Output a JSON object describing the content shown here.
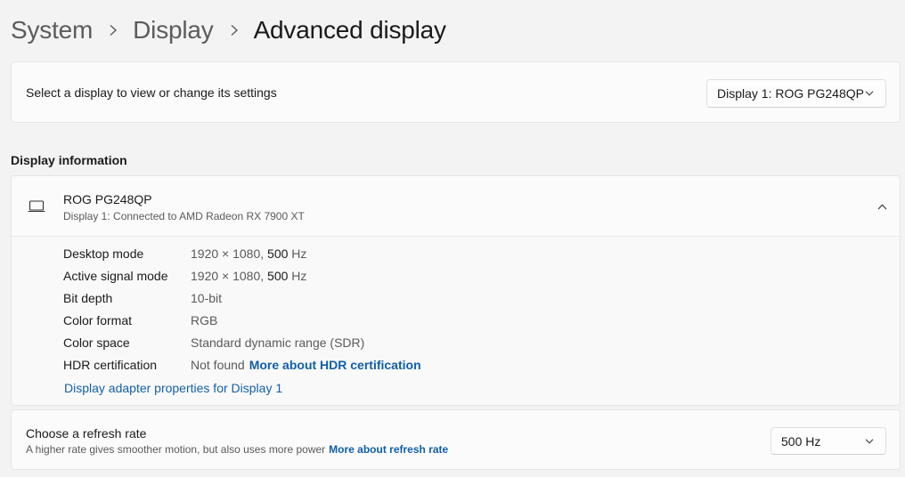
{
  "breadcrumb": {
    "items": [
      "System",
      "Display",
      "Advanced display"
    ]
  },
  "select_display": {
    "label": "Select a display to view or change its settings",
    "selected": "Display 1: ROG PG248QP"
  },
  "display_information": {
    "title": "Display information",
    "monitor_name": "ROG PG248QP",
    "monitor_sub": "Display 1: Connected to AMD Radeon RX 7900 XT",
    "rows": [
      {
        "key": "Desktop mode",
        "value": "1920 × 1080,",
        "value_emph": "500",
        "value_tail": "Hz"
      },
      {
        "key": "Active signal mode",
        "value": "1920 × 1080,",
        "value_emph": "500",
        "value_tail": "Hz"
      },
      {
        "key": "Bit depth",
        "value": "10-bit"
      },
      {
        "key": "Color format",
        "value": "RGB"
      },
      {
        "key": "Color space",
        "value": "Standard dynamic range (SDR)"
      },
      {
        "key": "HDR certification",
        "value": "Not found",
        "link": "More about HDR certification"
      }
    ],
    "adapter_link": "Display adapter properties for Display 1"
  },
  "refresh_rate": {
    "title": "Choose a refresh rate",
    "subtitle": "A higher rate gives smoother motion, but also uses more power",
    "link": "More about refresh rate",
    "selected": "500 Hz"
  },
  "colors": {
    "accent_link": "#0f5faa",
    "background": "#f3f3f3",
    "card": "#fbfbfb"
  },
  "icons": [
    "chevron-right-icon",
    "chevron-down-icon",
    "chevron-up-icon",
    "laptop-monitor-icon"
  ]
}
